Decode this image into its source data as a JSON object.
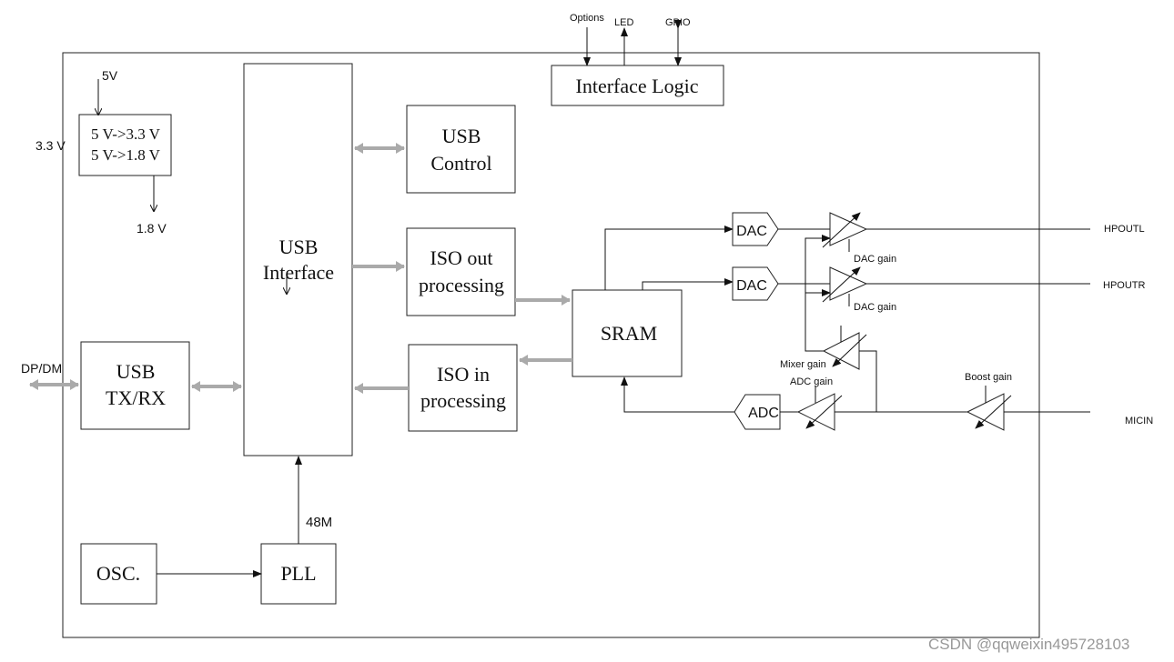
{
  "blocks": {
    "regulator_line1": "5 V->3.3 V",
    "regulator_line2": "5 V->1.8 V",
    "usb_interface_line1": "USB",
    "usb_interface_line2": "Interface",
    "usb_control_line1": "USB",
    "usb_control_line2": "Control",
    "iso_out_line1": "ISO out",
    "iso_out_line2": "processing",
    "iso_in_line1": "ISO in",
    "iso_in_line2": "processing",
    "sram": "SRAM",
    "usb_txrx_line1": "USB",
    "usb_txrx_line2": "TX/RX",
    "osc": "OSC.",
    "pll": "PLL",
    "interface_logic": "Interface Logic",
    "dac1": "DAC",
    "dac2": "DAC",
    "adc": "ADC"
  },
  "labels": {
    "five_v": "5V",
    "three_three_v": "3.3 V",
    "one_eight_v": "1.8 V",
    "dp_dm": "DP/DM",
    "clock_48m": "48M",
    "options": "Options",
    "led": "LED",
    "gpio": "GPIO",
    "hpoutl": "HPOUTL",
    "hpoutr": "HPOUTR",
    "micin": "MICIN",
    "dac_gain_1": "DAC gain",
    "dac_gain_2": "DAC gain",
    "mixer_gain": "Mixer gain",
    "adc_gain": "ADC gain",
    "boost_gain": "Boost gain"
  },
  "watermark": "CSDN @qqweixin495728103",
  "colors": {
    "line": "#111111",
    "bus_arrow": "#aaaaaa"
  }
}
